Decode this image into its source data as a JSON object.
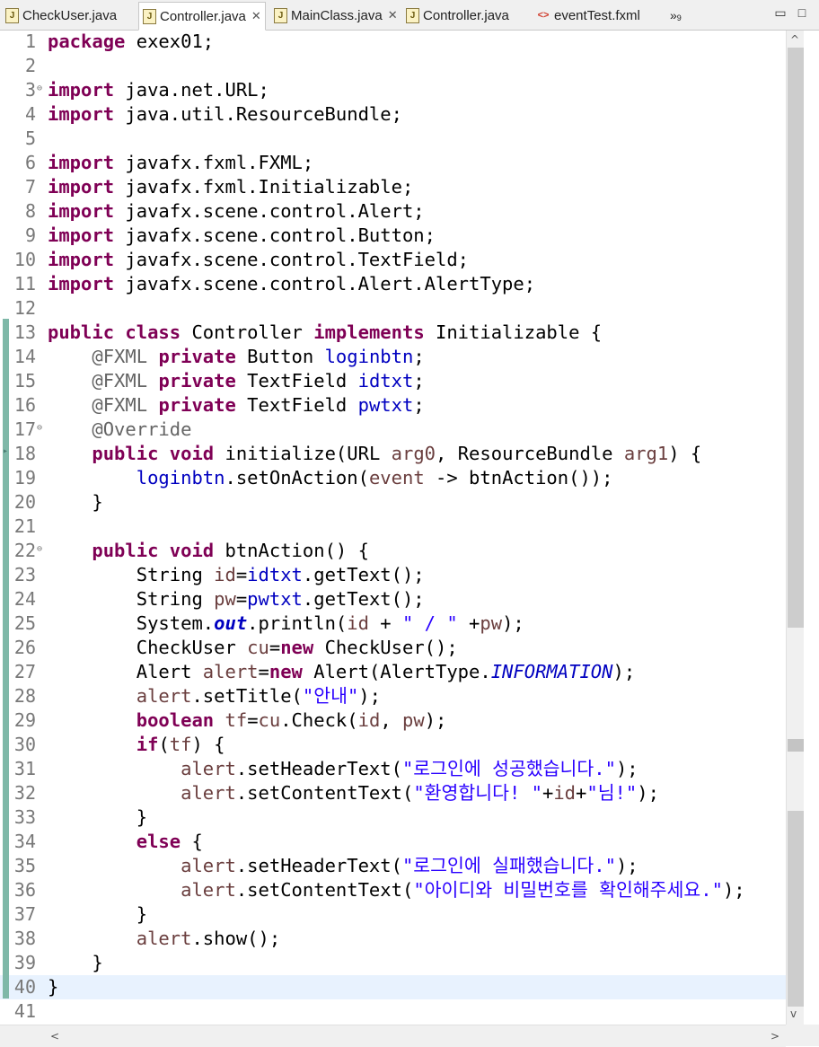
{
  "tabs": [
    {
      "label": "CheckUser.java",
      "icon": "java-file-icon",
      "active": false,
      "closable": false
    },
    {
      "label": "Controller.java",
      "icon": "java-file-icon",
      "active": true,
      "closable": true
    },
    {
      "label": "MainClass.java",
      "icon": "java-file-icon",
      "active": false,
      "closable": true
    },
    {
      "label": "Controller.java",
      "icon": "java-file-icon",
      "active": false,
      "closable": false
    },
    {
      "label": "eventTest.fxml",
      "icon": "fxml-file-icon",
      "active": false,
      "closable": false
    }
  ],
  "overflow": {
    "glyph": "»",
    "count": "9"
  },
  "window": {
    "minimize": "▭",
    "maximize": "□"
  },
  "colors": {
    "keyword": "#7f0055",
    "field": "#0000c0",
    "string": "#2a00ff",
    "annotation": "#646464",
    "local": "#6a3e3e",
    "current_line": "#e8f2fe"
  },
  "current_line": 40,
  "lines": [
    {
      "n": "1",
      "fold": "",
      "tokens": [
        {
          "t": "package",
          "c": "k"
        },
        {
          "t": " exex01;",
          "c": ""
        }
      ]
    },
    {
      "n": "2",
      "fold": "",
      "tokens": []
    },
    {
      "n": "3",
      "fold": "⊖",
      "tokens": [
        {
          "t": "import",
          "c": "k"
        },
        {
          "t": " java.net.URL;",
          "c": ""
        }
      ]
    },
    {
      "n": "4",
      "fold": "",
      "tokens": [
        {
          "t": "import",
          "c": "k"
        },
        {
          "t": " java.util.ResourceBundle;",
          "c": ""
        }
      ]
    },
    {
      "n": "5",
      "fold": "",
      "tokens": []
    },
    {
      "n": "6",
      "fold": "",
      "tokens": [
        {
          "t": "import",
          "c": "k"
        },
        {
          "t": " javafx.fxml.FXML;",
          "c": ""
        }
      ]
    },
    {
      "n": "7",
      "fold": "",
      "tokens": [
        {
          "t": "import",
          "c": "k"
        },
        {
          "t": " javafx.fxml.Initializable;",
          "c": ""
        }
      ]
    },
    {
      "n": "8",
      "fold": "",
      "tokens": [
        {
          "t": "import",
          "c": "k"
        },
        {
          "t": " javafx.scene.control.Alert;",
          "c": ""
        }
      ]
    },
    {
      "n": "9",
      "fold": "",
      "tokens": [
        {
          "t": "import",
          "c": "k"
        },
        {
          "t": " javafx.scene.control.Button;",
          "c": ""
        }
      ]
    },
    {
      "n": "10",
      "fold": "",
      "tokens": [
        {
          "t": "import",
          "c": "k"
        },
        {
          "t": " javafx.scene.control.TextField;",
          "c": ""
        }
      ]
    },
    {
      "n": "11",
      "fold": "",
      "tokens": [
        {
          "t": "import",
          "c": "k"
        },
        {
          "t": " javafx.scene.control.Alert.AlertType;",
          "c": ""
        }
      ]
    },
    {
      "n": "12",
      "fold": "",
      "tokens": []
    },
    {
      "n": "13",
      "fold": "",
      "tokens": [
        {
          "t": "public",
          "c": "k"
        },
        {
          "t": " ",
          "c": ""
        },
        {
          "t": "class",
          "c": "k"
        },
        {
          "t": " Controller ",
          "c": ""
        },
        {
          "t": "implements",
          "c": "k"
        },
        {
          "t": " Initializable {",
          "c": ""
        }
      ]
    },
    {
      "n": "14",
      "fold": "",
      "tokens": [
        {
          "t": "    ",
          "c": ""
        },
        {
          "t": "@FXML",
          "c": "a"
        },
        {
          "t": " ",
          "c": ""
        },
        {
          "t": "private",
          "c": "k"
        },
        {
          "t": " Button ",
          "c": ""
        },
        {
          "t": "loginbtn",
          "c": "f"
        },
        {
          "t": ";",
          "c": ""
        }
      ]
    },
    {
      "n": "15",
      "fold": "",
      "tokens": [
        {
          "t": "    ",
          "c": ""
        },
        {
          "t": "@FXML",
          "c": "a"
        },
        {
          "t": " ",
          "c": ""
        },
        {
          "t": "private",
          "c": "k"
        },
        {
          "t": " TextField ",
          "c": ""
        },
        {
          "t": "idtxt",
          "c": "f"
        },
        {
          "t": ";",
          "c": ""
        }
      ]
    },
    {
      "n": "16",
      "fold": "",
      "tokens": [
        {
          "t": "    ",
          "c": ""
        },
        {
          "t": "@FXML",
          "c": "a"
        },
        {
          "t": " ",
          "c": ""
        },
        {
          "t": "private",
          "c": "k"
        },
        {
          "t": " TextField ",
          "c": ""
        },
        {
          "t": "pwtxt",
          "c": "f"
        },
        {
          "t": ";",
          "c": ""
        }
      ]
    },
    {
      "n": "17",
      "fold": "⊖",
      "tokens": [
        {
          "t": "    ",
          "c": ""
        },
        {
          "t": "@Override",
          "c": "a"
        }
      ]
    },
    {
      "n": "18",
      "fold": "",
      "tokens": [
        {
          "t": "    ",
          "c": ""
        },
        {
          "t": "public",
          "c": "k"
        },
        {
          "t": " ",
          "c": ""
        },
        {
          "t": "void",
          "c": "k"
        },
        {
          "t": " initialize(URL ",
          "c": ""
        },
        {
          "t": "arg0",
          "c": "l"
        },
        {
          "t": ", ResourceBundle ",
          "c": ""
        },
        {
          "t": "arg1",
          "c": "l"
        },
        {
          "t": ") {",
          "c": ""
        }
      ]
    },
    {
      "n": "19",
      "fold": "",
      "tokens": [
        {
          "t": "        ",
          "c": ""
        },
        {
          "t": "loginbtn",
          "c": "f"
        },
        {
          "t": ".setOnAction(",
          "c": ""
        },
        {
          "t": "event",
          "c": "l"
        },
        {
          "t": " -> btnAction());",
          "c": ""
        }
      ]
    },
    {
      "n": "20",
      "fold": "",
      "tokens": [
        {
          "t": "    }",
          "c": ""
        }
      ]
    },
    {
      "n": "21",
      "fold": "",
      "tokens": []
    },
    {
      "n": "22",
      "fold": "⊖",
      "tokens": [
        {
          "t": "    ",
          "c": ""
        },
        {
          "t": "public",
          "c": "k"
        },
        {
          "t": " ",
          "c": ""
        },
        {
          "t": "void",
          "c": "k"
        },
        {
          "t": " btnAction() {",
          "c": ""
        }
      ]
    },
    {
      "n": "23",
      "fold": "",
      "tokens": [
        {
          "t": "        String ",
          "c": ""
        },
        {
          "t": "id",
          "c": "l"
        },
        {
          "t": "=",
          "c": ""
        },
        {
          "t": "idtxt",
          "c": "f"
        },
        {
          "t": ".getText();",
          "c": ""
        }
      ]
    },
    {
      "n": "24",
      "fold": "",
      "tokens": [
        {
          "t": "        String ",
          "c": ""
        },
        {
          "t": "pw",
          "c": "l"
        },
        {
          "t": "=",
          "c": ""
        },
        {
          "t": "pwtxt",
          "c": "f"
        },
        {
          "t": ".getText();",
          "c": ""
        }
      ]
    },
    {
      "n": "25",
      "fold": "",
      "tokens": [
        {
          "t": "        System.",
          "c": ""
        },
        {
          "t": "out",
          "c": "sf"
        },
        {
          "t": ".println(",
          "c": ""
        },
        {
          "t": "id",
          "c": "l"
        },
        {
          "t": " + ",
          "c": ""
        },
        {
          "t": "\" / \"",
          "c": "s"
        },
        {
          "t": " +",
          "c": ""
        },
        {
          "t": "pw",
          "c": "l"
        },
        {
          "t": ");",
          "c": ""
        }
      ]
    },
    {
      "n": "26",
      "fold": "",
      "tokens": [
        {
          "t": "        CheckUser ",
          "c": ""
        },
        {
          "t": "cu",
          "c": "l"
        },
        {
          "t": "=",
          "c": ""
        },
        {
          "t": "new",
          "c": "k"
        },
        {
          "t": " CheckUser();",
          "c": ""
        }
      ]
    },
    {
      "n": "27",
      "fold": "",
      "tokens": [
        {
          "t": "        Alert ",
          "c": ""
        },
        {
          "t": "alert",
          "c": "l"
        },
        {
          "t": "=",
          "c": ""
        },
        {
          "t": "new",
          "c": "k"
        },
        {
          "t": " Alert(AlertType.",
          "c": ""
        },
        {
          "t": "INFORMATION",
          "c": "kf"
        },
        {
          "t": ");",
          "c": ""
        }
      ]
    },
    {
      "n": "28",
      "fold": "",
      "tokens": [
        {
          "t": "        ",
          "c": ""
        },
        {
          "t": "alert",
          "c": "l"
        },
        {
          "t": ".setTitle(",
          "c": ""
        },
        {
          "t": "\"안내\"",
          "c": "s"
        },
        {
          "t": ");",
          "c": ""
        }
      ]
    },
    {
      "n": "29",
      "fold": "",
      "tokens": [
        {
          "t": "        ",
          "c": ""
        },
        {
          "t": "boolean",
          "c": "k"
        },
        {
          "t": " ",
          "c": ""
        },
        {
          "t": "tf",
          "c": "l"
        },
        {
          "t": "=",
          "c": ""
        },
        {
          "t": "cu",
          "c": "l"
        },
        {
          "t": ".Check(",
          "c": ""
        },
        {
          "t": "id",
          "c": "l"
        },
        {
          "t": ", ",
          "c": ""
        },
        {
          "t": "pw",
          "c": "l"
        },
        {
          "t": ");",
          "c": ""
        }
      ]
    },
    {
      "n": "30",
      "fold": "",
      "tokens": [
        {
          "t": "        ",
          "c": ""
        },
        {
          "t": "if",
          "c": "k"
        },
        {
          "t": "(",
          "c": ""
        },
        {
          "t": "tf",
          "c": "l"
        },
        {
          "t": ") {",
          "c": ""
        }
      ]
    },
    {
      "n": "31",
      "fold": "",
      "tokens": [
        {
          "t": "            ",
          "c": ""
        },
        {
          "t": "alert",
          "c": "l"
        },
        {
          "t": ".setHeaderText(",
          "c": ""
        },
        {
          "t": "\"로그인에 성공했습니다.\"",
          "c": "s"
        },
        {
          "t": ");",
          "c": ""
        }
      ]
    },
    {
      "n": "32",
      "fold": "",
      "tokens": [
        {
          "t": "            ",
          "c": ""
        },
        {
          "t": "alert",
          "c": "l"
        },
        {
          "t": ".setContentText(",
          "c": ""
        },
        {
          "t": "\"환영합니다! \"",
          "c": "s"
        },
        {
          "t": "+",
          "c": ""
        },
        {
          "t": "id",
          "c": "l"
        },
        {
          "t": "+",
          "c": ""
        },
        {
          "t": "\"님!\"",
          "c": "s"
        },
        {
          "t": ");",
          "c": ""
        }
      ]
    },
    {
      "n": "33",
      "fold": "",
      "tokens": [
        {
          "t": "        }",
          "c": ""
        }
      ]
    },
    {
      "n": "34",
      "fold": "",
      "tokens": [
        {
          "t": "        ",
          "c": ""
        },
        {
          "t": "else",
          "c": "k"
        },
        {
          "t": " {",
          "c": ""
        }
      ]
    },
    {
      "n": "35",
      "fold": "",
      "tokens": [
        {
          "t": "            ",
          "c": ""
        },
        {
          "t": "alert",
          "c": "l"
        },
        {
          "t": ".setHeaderText(",
          "c": ""
        },
        {
          "t": "\"로그인에 실패했습니다.\"",
          "c": "s"
        },
        {
          "t": ");",
          "c": ""
        }
      ]
    },
    {
      "n": "36",
      "fold": "",
      "tokens": [
        {
          "t": "            ",
          "c": ""
        },
        {
          "t": "alert",
          "c": "l"
        },
        {
          "t": ".setContentText(",
          "c": ""
        },
        {
          "t": "\"아이디와 비밀번호를 확인해주세요.\"",
          "c": "s"
        },
        {
          "t": ");",
          "c": ""
        }
      ]
    },
    {
      "n": "37",
      "fold": "",
      "tokens": [
        {
          "t": "        }",
          "c": ""
        }
      ]
    },
    {
      "n": "38",
      "fold": "",
      "tokens": [
        {
          "t": "        ",
          "c": ""
        },
        {
          "t": "alert",
          "c": "l"
        },
        {
          "t": ".show();",
          "c": ""
        }
      ]
    },
    {
      "n": "39",
      "fold": "",
      "tokens": [
        {
          "t": "    }",
          "c": ""
        }
      ]
    },
    {
      "n": "40",
      "fold": "",
      "tokens": [
        {
          "t": "}",
          "c": ""
        }
      ]
    },
    {
      "n": "41",
      "fold": "",
      "tokens": []
    }
  ]
}
